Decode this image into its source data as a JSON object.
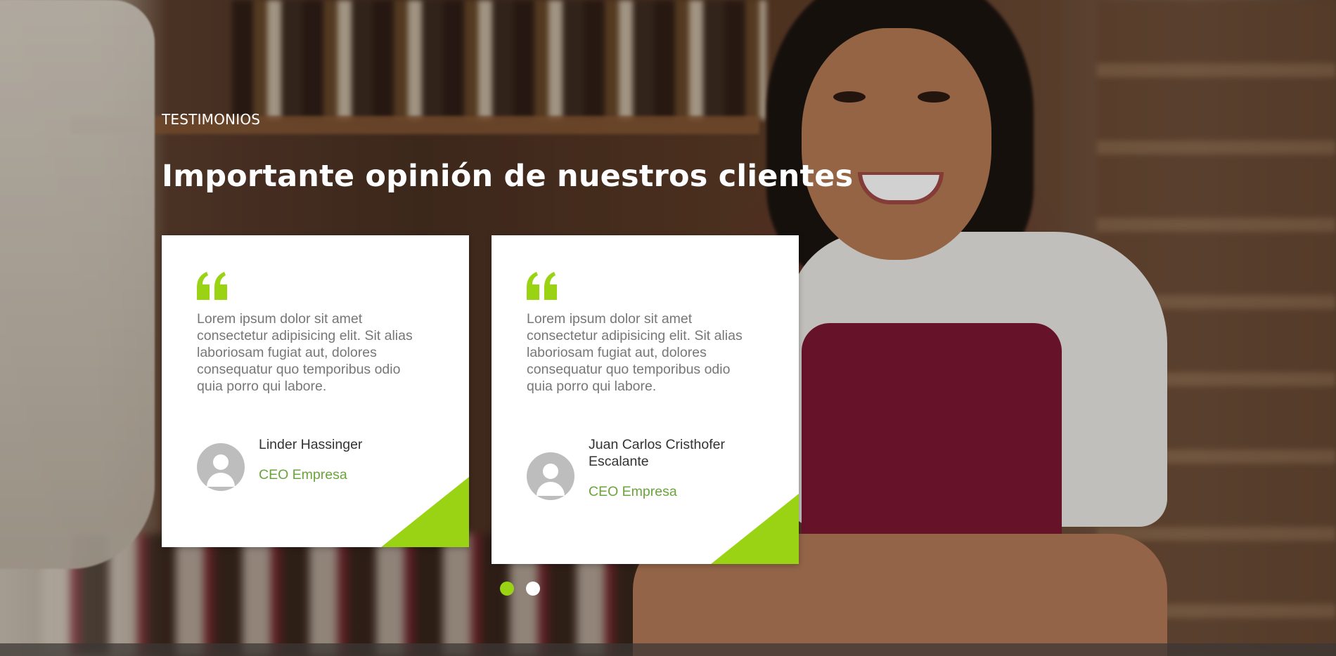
{
  "section": {
    "eyebrow": "TESTIMONIOS",
    "title": "Importante opinión de nuestros clientes"
  },
  "testimonials": [
    {
      "quote": "Lorem ipsum dolor sit amet consectetur adipisicing elit. Sit alias laboriosam fugiat aut, dolores consequatur quo temporibus odio quia porro qui labore.",
      "name": "Linder Hassinger",
      "role": "CEO Empresa",
      "avatar_icon": "user-avatar-icon"
    },
    {
      "quote": "Lorem ipsum dolor sit amet consectetur adipisicing elit. Sit alias laboriosam fugiat aut, dolores consequatur quo temporibus odio quia porro qui labore.",
      "name": "Juan Carlos Cristhofer Escalante",
      "role": "CEO Empresa",
      "avatar_icon": "user-avatar-icon"
    }
  ],
  "carousel": {
    "pages": 2,
    "active_page": 1
  },
  "colors": {
    "accent": "#99d314",
    "role_text": "#6aa43a",
    "quote_text": "#777777",
    "card_bg": "#ffffff"
  },
  "icons": {
    "quote": "quote-icon"
  }
}
